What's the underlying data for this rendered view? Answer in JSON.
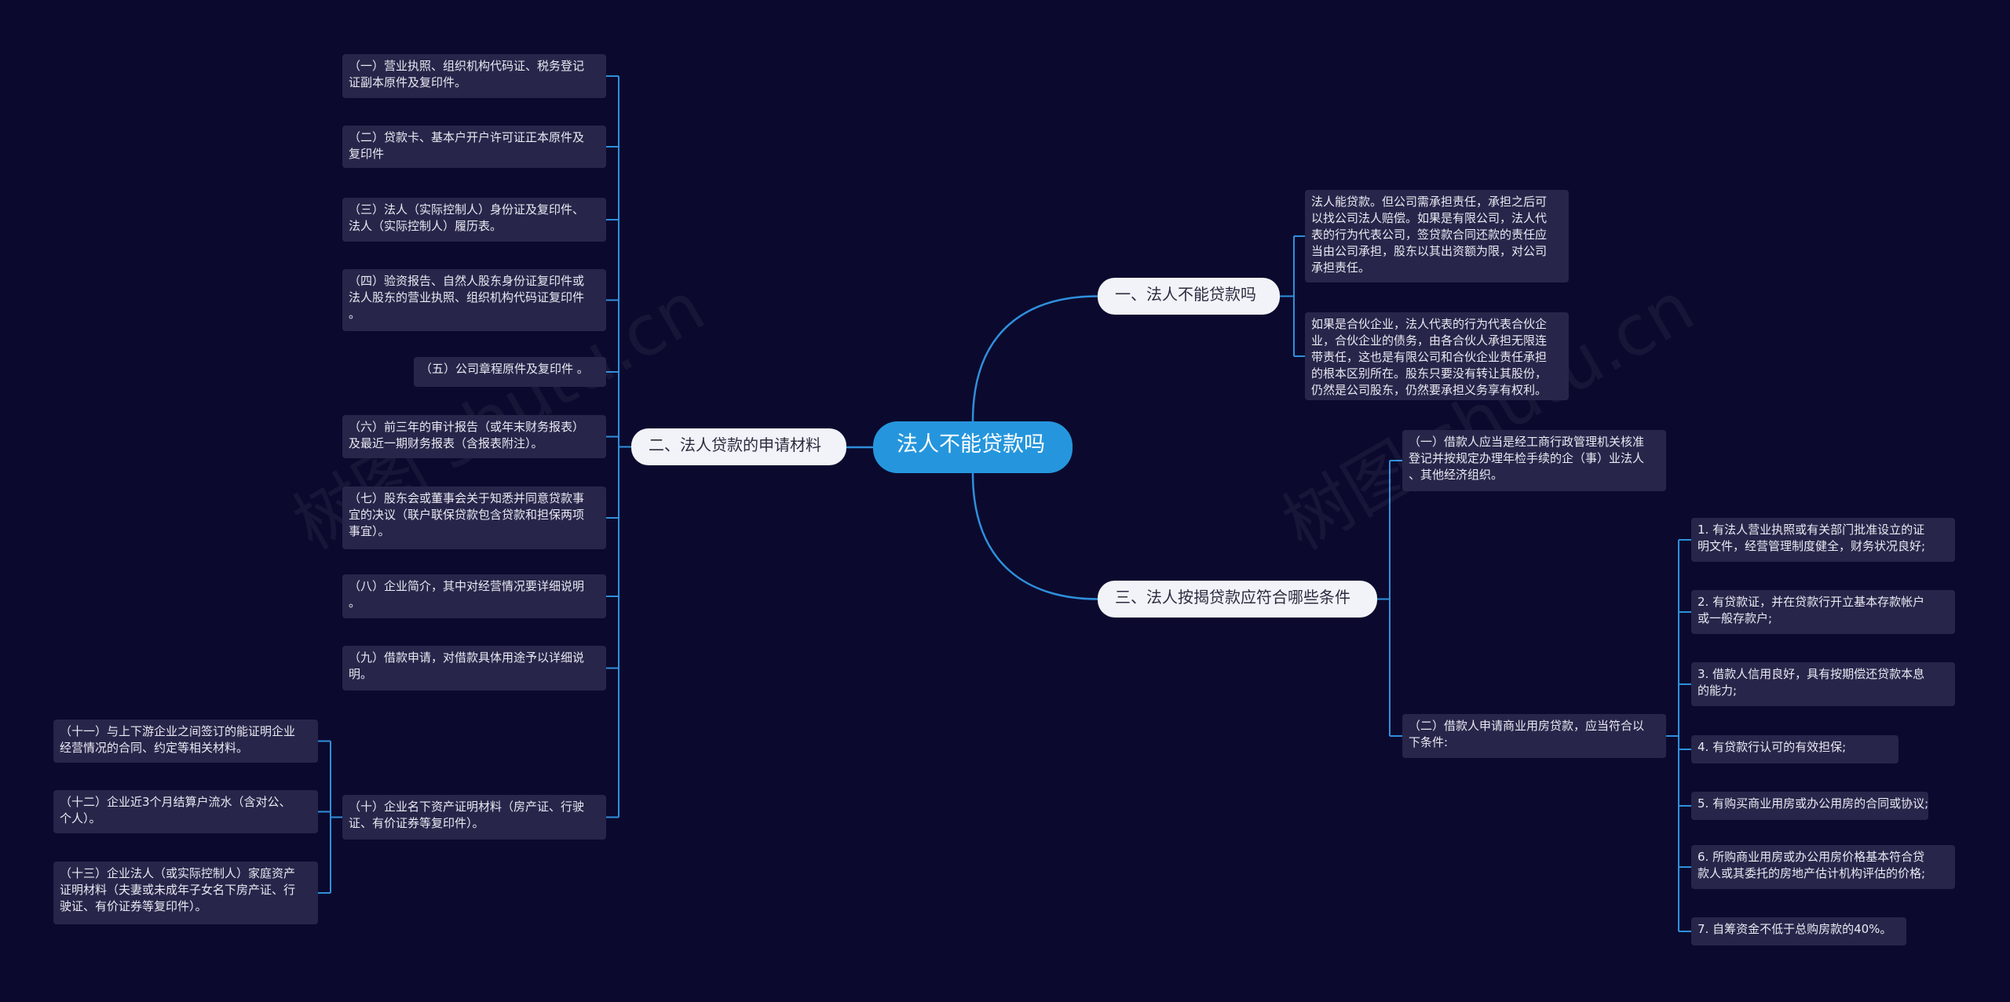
{
  "root": "法人不能贷款吗",
  "watermarks": [
    "树图 shutu.cn",
    "树图 shutu.cn"
  ],
  "branches": {
    "b1": {
      "label": "一、法人不能贷款吗",
      "children": [
        "法人能贷款。但公司需承担责任，承担之后可\n以找公司法人赔偿。如果是有限公司，法人代\n表的行为代表公司，签贷款合同还款的责任应\n当由公司承担，股东以其出资额为限，对公司\n承担责任。",
        "如果是合伙企业，法人代表的行为代表合伙企\n业，合伙企业的债务，由各合伙人承担无限连\n带责任，这也是有限公司和合伙企业责任承担\n的根本区别所在。股东只要没有转让其股份，\n仍然是公司股东，仍然要承担义务享有权利。"
      ]
    },
    "b2": {
      "label": "二、法人贷款的申请材料",
      "children": [
        "（一）营业执照、组织机构代码证、税务登记\n证副本原件及复印件。",
        "（二）贷款卡、基本户开户许可证正本原件及\n复印件",
        "（三）法人（实际控制人）身份证及复印件、\n法人（实际控制人）履历表。",
        "（四）验资报告、自然人股东身份证复印件或\n法人股东的营业执照、组织机构代码证复印件\n。",
        "（五）公司章程原件及复印件 。",
        "（六）前三年的审计报告（或年末财务报表）\n及最近一期财务报表（含报表附注）。",
        "（七）股东会或董事会关于知悉并同意贷款事\n宜的决议（联户联保贷款包含贷款和担保两项\n事宜）。",
        "（八）企业简介，其中对经营情况要详细说明\n。",
        "（九）借款申请，对借款具体用途予以详细说\n明。",
        "（十）企业名下资产证明材料（房产证、行驶\n证、有价证券等复印件）。"
      ],
      "sub": [
        "（十一）与上下游企业之间签订的能证明企业\n经营情况的合同、约定等相关材料。",
        "（十二）企业近3个月结算户流水（含对公、\n个人）。",
        "（十三）企业法人（或实际控制人）家庭资产\n证明材料（夫妻或未成年子女名下房产证、行\n驶证、有价证券等复印件）。"
      ]
    },
    "b3": {
      "label": "三、法人按揭贷款应符合哪些条件",
      "children": [
        "（一）借款人应当是经工商行政管理机关核准\n登记并按规定办理年检手续的企（事）业法人\n、其他经济组织。",
        "（二）借款人申请商业用房贷款，应当符合以\n下条件:"
      ],
      "sub": [
        "1. 有法人营业执照或有关部门批准设立的证\n明文件，经营管理制度健全，财务状况良好;",
        "2. 有贷款证，并在贷款行开立基本存款帐户\n或一般存款户;",
        "3. 借款人信用良好，具有按期偿还贷款本息\n的能力;",
        "4. 有贷款行认可的有效担保;",
        "5. 有购买商业用房或办公用房的合同或协议;",
        "6. 所购商业用房或办公用房价格基本符合贷\n款人或其委托的房地产估计机构评估的价格;",
        "7. 自筹资金不低于总购房款的40%。"
      ]
    }
  },
  "colors": {
    "background": "#0b0a2e",
    "line": "#2f8fdc",
    "root": "#2596dd",
    "branch": "#f2f3f8",
    "leaf": "#27264a"
  }
}
